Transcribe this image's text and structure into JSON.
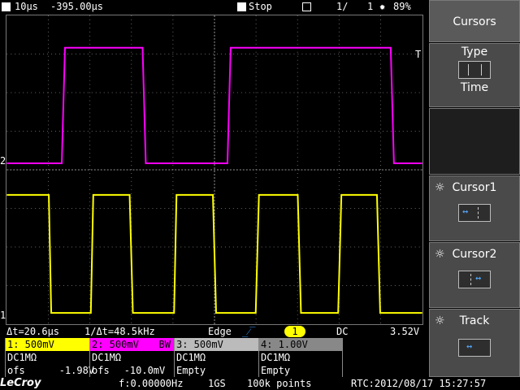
{
  "topbar": {
    "timebase": "10µs",
    "delay": "-395.00µs",
    "run_state": "Stop",
    "save_icon": "clipboard-icon",
    "page": "1/",
    "page_num": "1",
    "battery": "89%"
  },
  "colors": {
    "ch1": "#ffff00",
    "ch2": "#ff00ff",
    "ch3": "#ffffff",
    "ch4": "#aaaaaa",
    "grid": "#666666"
  },
  "markers": {
    "ch2": "2",
    "ch1": "1",
    "trigger_level": "T"
  },
  "waveforms": {
    "ch2": {
      "high_div": 1.0,
      "low_div": 0.0,
      "edges_div": [
        0.0,
        1.36,
        3.3,
        3.95,
        5.4,
        9.4,
        9.9
      ]
    },
    "ch1": {
      "high_div": 1.0,
      "low_div": 0.0
    }
  },
  "menu": {
    "title": "Cursors",
    "type_label": "Type",
    "type_value": "Time",
    "cursor1": "Cursor1",
    "cursor2": "Cursor2",
    "track": "Track"
  },
  "info": {
    "delta_t": "Δt=20.6µs",
    "inv_delta_t": "1/Δt=48.5kHz",
    "trigger_type": "Edge",
    "trigger_source": "1",
    "coupling": "DC",
    "trigger_level": "3.52V"
  },
  "channels": [
    {
      "head": "1: 500mV",
      "line2": "DC1MΩ",
      "line3a": "ofs",
      "line3b": "-1.98V"
    },
    {
      "head": "2: 500mV",
      "bw": "BW",
      "line2": "DC1MΩ",
      "line3a": "ofs",
      "line3b": "-10.0mV"
    },
    {
      "head": "3: 500mV",
      "line2": "DC1MΩ",
      "line3a": "Empty",
      "line3b": ""
    },
    {
      "head": "4: 1.00V",
      "line2": "DC1MΩ",
      "line3a": "Empty",
      "line3b": ""
    }
  ],
  "footer": {
    "brand": "LeCroy",
    "freq": "f:0.00000Hz",
    "sample_rate": "1GS",
    "points": "100k points",
    "rtc": "RTC:2012/08/17 15:27:57"
  }
}
